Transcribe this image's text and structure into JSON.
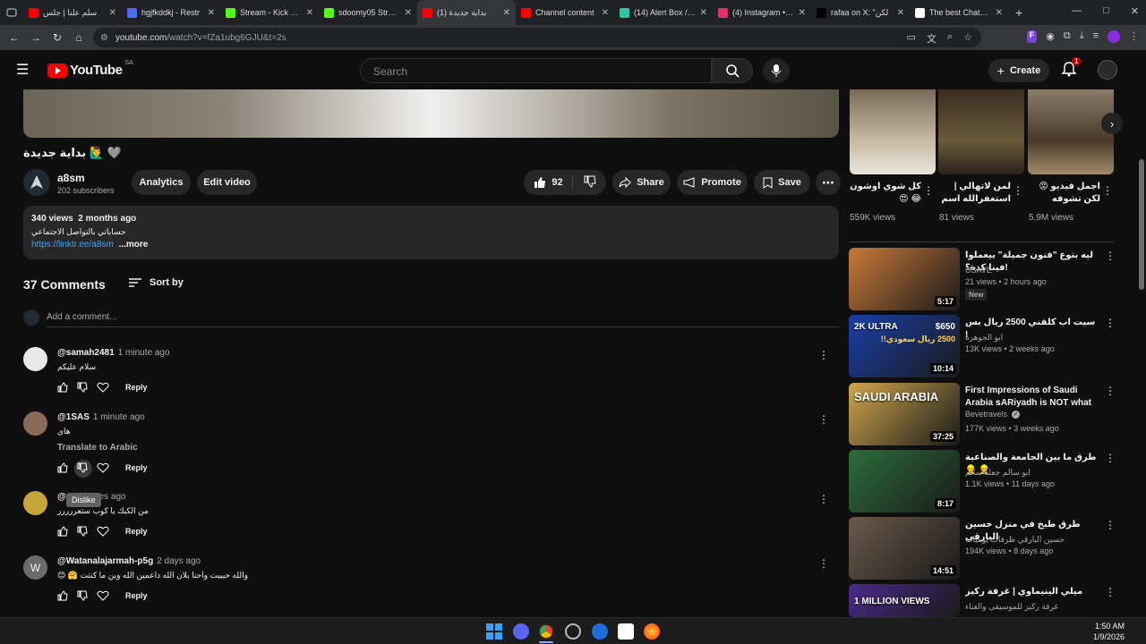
{
  "browser": {
    "tabs": [
      {
        "label": "سلم علنا | جلس",
        "color": "#ff0000"
      },
      {
        "label": "hgjfkddkj - Restr",
        "color": "#4a6cf7"
      },
      {
        "label": "Stream - Kick Da:",
        "color": "#53fc18"
      },
      {
        "label": "sdoomy05 Stream",
        "color": "#53fc18"
      },
      {
        "label": "(1) بداية جديدة",
        "color": "#ff0000"
      },
      {
        "label": "Channel content",
        "color": "#ff0000"
      },
      {
        "label": "(14) Alert Box / St",
        "color": "#31c3a2"
      },
      {
        "label": "(4) Instagram • M",
        "color": "#e1306c"
      },
      {
        "label": "rafaa on X: \"لكن",
        "color": "#000000"
      },
      {
        "label": "The best ChatBot",
        "color": "#ffffff"
      }
    ],
    "new_tab_symbol": "+",
    "window_controls": [
      "—",
      "□",
      "✕"
    ],
    "url_host": "youtube.com",
    "url_rest": "/watch?v=fZa1ubg6GJU&t=2s"
  },
  "youtube": {
    "logo_text": "YouTube",
    "region": "SA",
    "search_placeholder": "Search",
    "create_label": "Create",
    "notification_count": "1"
  },
  "video": {
    "title": "بداية جديدة 🙋‍♂️ 🩶",
    "channel_name": "a8sm",
    "subscribers": "202 subscribers",
    "analytics_label": "Analytics",
    "edit_label": "Edit video",
    "likes": "92",
    "share_label": "Share",
    "promote_label": "Promote",
    "save_label": "Save",
    "description": {
      "views": "340 views",
      "age": "2 months ago",
      "text": "حساباتي بالتواصل الاجتماعي",
      "link": "https://linktr.ee/a8sm",
      "more_label": "...more"
    }
  },
  "comments_section": {
    "count_label": "37 Comments",
    "sort_label": "Sort by",
    "add_placeholder": "Add a comment...",
    "reply_label": "Reply",
    "translate_label": "Translate to Arabic",
    "tooltip": "Dislike",
    "comments": [
      {
        "handle": "@samah2481",
        "time": "1 minute ago",
        "text": "سلام عليكم",
        "avatar_color": "#e8e8e8"
      },
      {
        "handle": "@1SAS",
        "time": "1 minute ago",
        "text": "هاي",
        "avatar_color": "#8a6a5a"
      },
      {
        "handle": "@",
        "time": "4 minutes ago",
        "text": "من الكبك يا كوب ستعررررر",
        "avatar_color": "#c6a53a"
      },
      {
        "handle": "@Watanalajarmah-p5g",
        "time": "2 days ago",
        "text": "والله حبيبت واحنا بلان الله داعمين الله وين ما كنتت 🤗 😊",
        "avatar_color": "#6b6b6b",
        "avatar_letter": "W"
      }
    ]
  },
  "shorts": [
    {
      "title": "كل شوي اوشون 😂 😍",
      "views": "559K views"
    },
    {
      "title": "لمن لاتهالي | استغفرالله اسم",
      "views": "81 views"
    },
    {
      "title": "اجمل فيديو 😡 لكن تشوفه باليوم",
      "views": "5.9M views"
    }
  ],
  "sidebar_videos": [
    {
      "title": "ليه بتوع \"فنون جميلة\" بيعملوا فينا كدة؟!",
      "channel": "USAVE",
      "views": "21 views • 2 hours ago",
      "badge": "New",
      "duration": "5:17",
      "thumb": "#c87a3a"
    },
    {
      "title": "سيت اب كلفني 2500 ريال بس !",
      "channel": "ابو الجوهرة",
      "views": "13K views • 2 weeks ago",
      "duration": "10:14",
      "thumb": "#1a3ea8",
      "thumb_text": "2K ULTRA",
      "price1": "$650",
      "price2": "2500 ريال سعودي!!"
    },
    {
      "title": "First Impressions of Saudi Arabia ꜱARiyadh is NOT what w...",
      "channel": "Bevetravels",
      "views": "177K views • 3 weeks ago",
      "duration": "37:25",
      "thumb": "#d1a64c",
      "thumb_text": "SAUDI ARABIA"
    },
    {
      "title": "طرق ما بين الجامعة والصناعية 👷 👷",
      "channel": "ابو سالم جعله سالم",
      "views": "1.1K views • 11 days ago",
      "duration": "8:17",
      "thumb": "#2b6e3a"
    },
    {
      "title": "طرق طبخ في منزل حسين البارقي",
      "channel": "حسين البارقي ظرفات يوميات",
      "views": "194K views • 8 days ago",
      "duration": "14:51",
      "thumb": "#6a5a4a"
    },
    {
      "title": "ميلي الينيماوي | غرفة ركيز",
      "channel": "غرفة ركيز للموسيقى والغناء",
      "views": "",
      "duration": "",
      "thumb": "#4a2a8a",
      "thumb_text": "1 MILLION VIEWS"
    }
  ],
  "taskbar": {
    "time": "1:50 AM",
    "date": "1/9/2026"
  }
}
